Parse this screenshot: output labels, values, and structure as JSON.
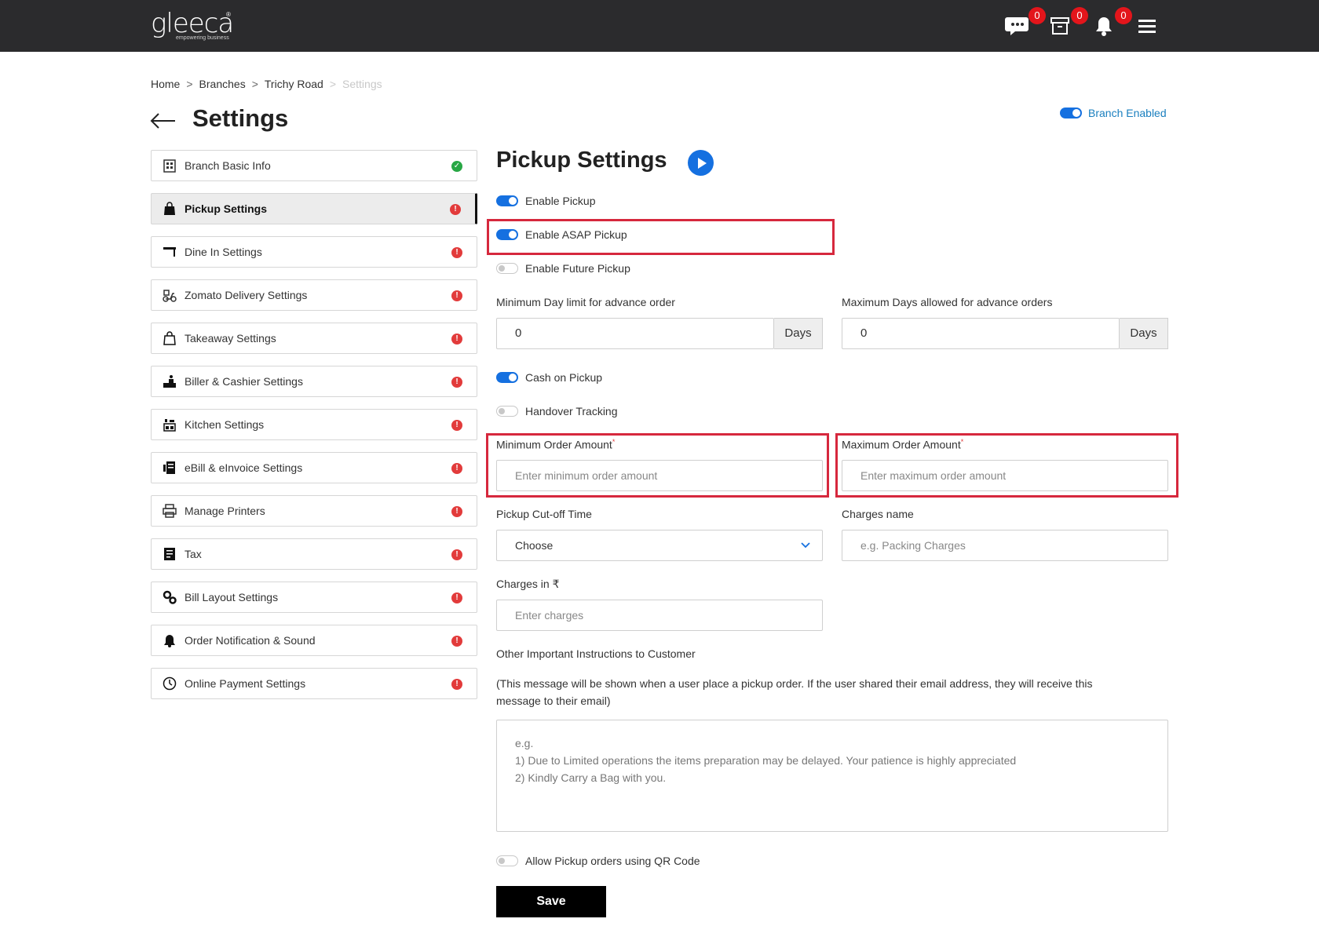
{
  "topbar": {
    "logo_text": "gleeca",
    "logo_tagline": "empowering business",
    "logo_reg": "®",
    "badges": {
      "messages": "0",
      "archive": "0",
      "notifications": "0"
    }
  },
  "breadcrumb": {
    "items": [
      "Home",
      "Branches",
      "Trichy Road",
      "Settings"
    ],
    "separator": ">"
  },
  "page": {
    "title": "Settings",
    "branch_toggle_label": "Branch Enabled"
  },
  "sidebar": {
    "items": [
      {
        "label": "Branch Basic Info",
        "status": "complete"
      },
      {
        "label": "Pickup Settings",
        "status": "incomplete"
      },
      {
        "label": "Dine In Settings",
        "status": "incomplete"
      },
      {
        "label": "Zomato Delivery Settings",
        "status": "incomplete"
      },
      {
        "label": "Takeaway Settings",
        "status": "incomplete"
      },
      {
        "label": "Biller & Cashier Settings",
        "status": "incomplete"
      },
      {
        "label": "Kitchen Settings",
        "status": "incomplete"
      },
      {
        "label": "eBill & eInvoice Settings",
        "status": "incomplete"
      },
      {
        "label": "Manage Printers",
        "status": "incomplete"
      },
      {
        "label": "Tax",
        "status": "incomplete"
      },
      {
        "label": "Bill Layout Settings",
        "status": "incomplete"
      },
      {
        "label": "Order Notification & Sound",
        "status": "incomplete"
      },
      {
        "label": "Online Payment Settings",
        "status": "incomplete"
      }
    ],
    "status_ok_glyph": "✓",
    "status_err_glyph": "!"
  },
  "main": {
    "title": "Pickup Settings",
    "toggles": {
      "enable_pickup": "Enable Pickup",
      "enable_asap": "Enable ASAP Pickup",
      "enable_future": "Enable Future Pickup",
      "cash_on_pickup": "Cash on Pickup",
      "handover_tracking": "Handover Tracking",
      "allow_qr": "Allow Pickup orders using QR Code"
    },
    "min_day": {
      "label": "Minimum Day limit for advance order",
      "value": "0",
      "addon": "Days"
    },
    "max_days": {
      "label": "Maximum Days allowed for advance orders",
      "value": "0",
      "addon": "Days"
    },
    "min_order": {
      "label": "Minimum Order Amount",
      "required": "*",
      "placeholder": "Enter minimum order amount"
    },
    "max_order": {
      "label": "Maximum Order Amount",
      "required": "*",
      "placeholder": "Enter maximum order amount"
    },
    "cutoff": {
      "label": "Pickup Cut-off Time",
      "value": "Choose"
    },
    "charges_name": {
      "label": "Charges name",
      "placeholder": "e.g. Packing Charges"
    },
    "charges": {
      "label": "Charges in ₹",
      "placeholder": "Enter charges"
    },
    "instructions": {
      "label": "Other Important Instructions to Customer",
      "help": "(This message will be shown when a user place a pickup order. If the user shared their email address, they will receive this message to their email)",
      "placeholder_line1": "e.g.",
      "placeholder_line2": "1) Due to Limited operations the items preparation may be delayed. Your patience is highly appreciated",
      "placeholder_line3": "2) Kindly Carry a Bag with you."
    },
    "save_label": "Save"
  }
}
